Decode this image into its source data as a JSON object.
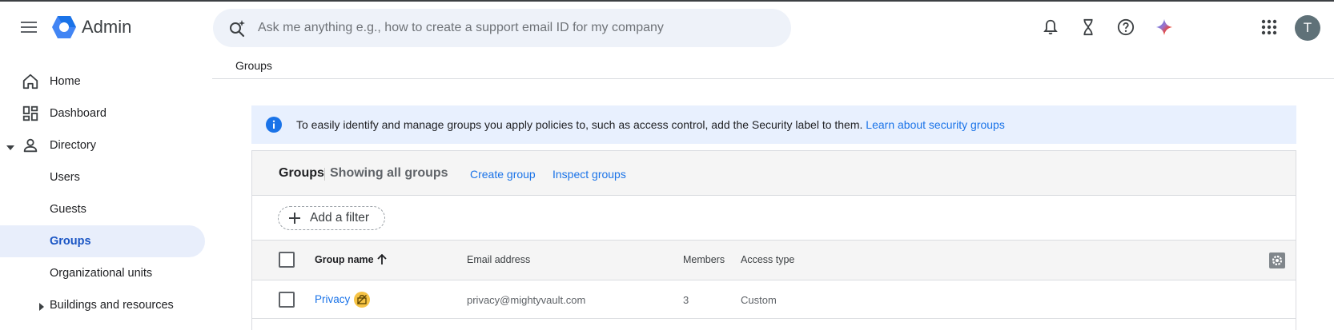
{
  "header": {
    "app_title": "Admin",
    "search_placeholder": "Ask me anything e.g., how to create a support email ID for my company",
    "avatar_initial": "T",
    "logo_colors": [
      "#1a73e8",
      "#4285f4"
    ],
    "icons": [
      "menu-icon",
      "search-spark-icon",
      "bell-icon",
      "hourglass-icon",
      "help-icon",
      "gemini-icon",
      "apps-icon"
    ]
  },
  "sidebar": {
    "items": [
      {
        "label": "Home",
        "icon": "home-icon"
      },
      {
        "label": "Dashboard",
        "icon": "dashboard-icon"
      },
      {
        "label": "Directory",
        "icon": "person-icon",
        "expanded": true
      },
      {
        "label": "Users"
      },
      {
        "label": "Guests"
      },
      {
        "label": "Groups",
        "active": true
      },
      {
        "label": "Organizational units"
      },
      {
        "label": "Buildings and resources",
        "expandable": true
      }
    ]
  },
  "main": {
    "breadcrumb": "Groups",
    "banner": {
      "text": "To easily identify and manage groups you apply policies to, such as access control, add the Security label to them.",
      "link": "Learn about security groups"
    },
    "card": {
      "title": "Groups",
      "subtitle": "Showing all groups",
      "create_link": "Create group",
      "inspect_link": "Inspect groups",
      "filter_label": "Add a filter"
    },
    "table": {
      "columns": [
        "Group name",
        "Email address",
        "Members",
        "Access type"
      ],
      "rows": [
        {
          "name": "Privacy",
          "email": "privacy@mightyvault.com",
          "members": "3",
          "access": "Custom"
        }
      ]
    }
  },
  "colors": {
    "accent": "#1a73e8",
    "active_bg": "#e8eefb",
    "banner_bg": "#e8f0fe",
    "badge": "#f6c344"
  }
}
